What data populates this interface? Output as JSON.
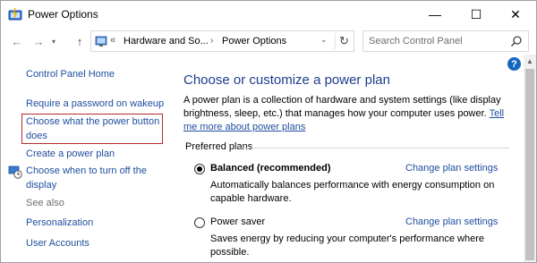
{
  "window": {
    "title": "Power Options",
    "app_icon": "power-options-icon",
    "minimize_glyph": "—",
    "maximize_glyph": "☐",
    "close_glyph": "✕"
  },
  "nav": {
    "back_glyph": "←",
    "forward_glyph": "→",
    "recent_glyph": "▾",
    "up_glyph": "↑",
    "address_chevron": "«",
    "breadcrumb": [
      "Hardware and So...",
      "Power Options"
    ],
    "breadcrumb_sep": "›",
    "dropdown_glyph": "⌄",
    "refresh_glyph": "↻",
    "search_placeholder": "Search Control Panel",
    "search_icon": "search-icon"
  },
  "sidebar": {
    "home": "Control Panel Home",
    "items": [
      "Require a password on wakeup",
      "Choose what the power button does",
      "Create a power plan",
      "Choose when to turn off the display"
    ],
    "see_also_label": "See also",
    "see_also": [
      "Personalization",
      "User Accounts"
    ]
  },
  "main": {
    "help_glyph": "?",
    "title": "Choose or customize a power plan",
    "description": "A power plan is a collection of hardware and system settings (like display brightness, sleep, etc.) that manages how your computer uses power. ",
    "description_link": "Tell me more about power plans",
    "section_label": "Preferred plans",
    "plans": [
      {
        "name": "Balanced (recommended)",
        "selected": true,
        "link": "Change plan settings",
        "description": "Automatically balances performance with energy consumption on capable hardware."
      },
      {
        "name": "Power saver",
        "selected": false,
        "link": "Change plan settings",
        "description": "Saves energy by reducing your computer's performance where possible."
      }
    ]
  },
  "colors": {
    "link": "#1e4e9e",
    "title": "#1e3c8c",
    "highlight_border": "#b52a2a",
    "help_badge": "#1565c0"
  },
  "scroll_up_glyph": "▲"
}
